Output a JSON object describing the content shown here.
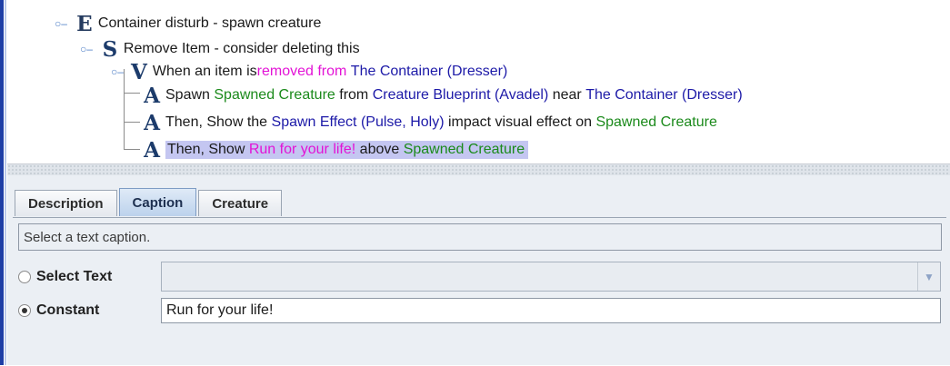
{
  "tree": {
    "event": {
      "glyph": "E",
      "prefix": "Container disturb - spawn creature"
    },
    "script": {
      "glyph": "S",
      "prefix": "Remove Item - consider deleting this"
    },
    "condition": {
      "glyph": "V",
      "parts": [
        "When an item is ",
        "removed from",
        " ",
        "The Container (Dresser)"
      ]
    },
    "action1": {
      "glyph": "A",
      "parts": [
        "Spawn ",
        "Spawned Creature",
        " from ",
        "Creature Blueprint (Avadel)",
        " near ",
        "The Container (Dresser)"
      ]
    },
    "action2": {
      "glyph": "A",
      "parts": [
        "Then, Show the ",
        "Spawn Effect (Pulse, Holy)",
        " impact visual effect on ",
        "Spawned Creature"
      ]
    },
    "action3": {
      "glyph": "A",
      "parts": [
        "Then, Show ",
        "Run for your life!",
        " above ",
        "Spawned Creature"
      ]
    },
    "toggle_expanded": "⚬"
  },
  "tabs": [
    "Description",
    "Caption",
    "Creature"
  ],
  "active_tab": "Caption",
  "caption_panel": {
    "description": "Select a text caption.",
    "select_text_label": "Select Text",
    "select_text_value": "",
    "constant_label": "Constant",
    "constant_value": "Run for your life!",
    "selected_option": "Constant"
  },
  "colors": {
    "reference": "#1d1aa8",
    "variable": "#1b8a1b",
    "keyword": "#e313d6",
    "selection": "#c4c6f1"
  }
}
